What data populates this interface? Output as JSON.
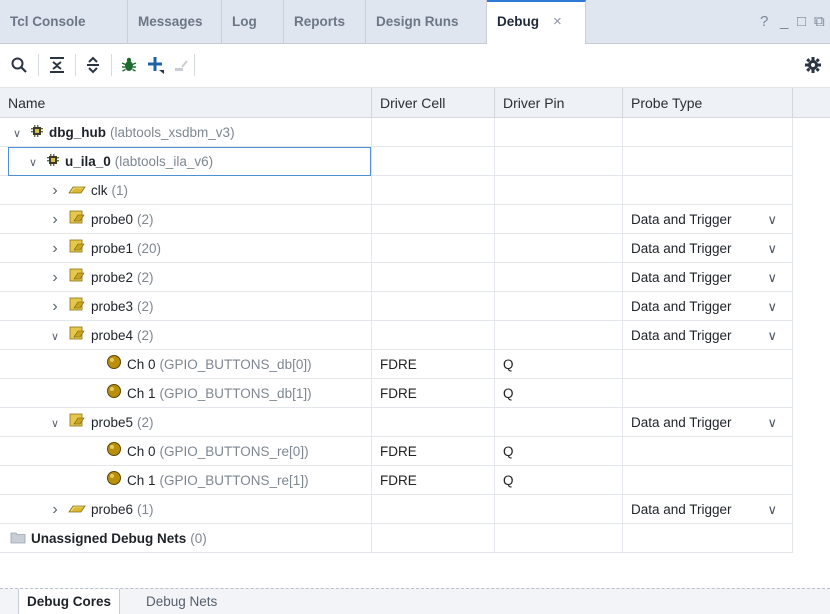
{
  "tabs": [
    {
      "label": "Tcl Console"
    },
    {
      "label": "Messages"
    },
    {
      "label": "Log"
    },
    {
      "label": "Reports"
    },
    {
      "label": "Design Runs"
    },
    {
      "label": "Debug",
      "active": true
    }
  ],
  "window_controls": {
    "help": "?",
    "minimize": "_",
    "restore": "□",
    "float": "⧉"
  },
  "toolbar": {
    "icons": [
      "search-icon",
      "collapse-all-icon",
      "expand-all-icon",
      "debug-bug-icon",
      "add-icon",
      "disabled-action-icon",
      "settings-gear-icon"
    ]
  },
  "columns": [
    "Name",
    "Driver Cell",
    "Driver Pin",
    "Probe Type"
  ],
  "rows": [
    {
      "indent": 0,
      "chev": "v",
      "icon": "core",
      "name": "dbg_hub",
      "detail": "(labtools_xsdbm_v3)",
      "cell": "",
      "pin": "",
      "type": ""
    },
    {
      "indent": 1,
      "chev": "v",
      "icon": "core",
      "name": "u_ila_0",
      "detail": "(labtools_ila_v6)",
      "cell": "",
      "pin": "",
      "type": ""
    },
    {
      "indent": 2,
      "chev": ">",
      "icon": "bus",
      "name": "clk",
      "detail": "(1)",
      "cell": "",
      "pin": "",
      "type": ""
    },
    {
      "indent": 2,
      "chev": ">",
      "icon": "probe",
      "name": "probe0",
      "detail": "(2)",
      "cell": "",
      "pin": "",
      "type": "Data and Trigger"
    },
    {
      "indent": 2,
      "chev": ">",
      "icon": "probe",
      "name": "probe1",
      "detail": "(20)",
      "cell": "",
      "pin": "",
      "type": "Data and Trigger"
    },
    {
      "indent": 2,
      "chev": ">",
      "icon": "probe",
      "name": "probe2",
      "detail": "(2)",
      "cell": "",
      "pin": "",
      "type": "Data and Trigger"
    },
    {
      "indent": 2,
      "chev": ">",
      "icon": "probe",
      "name": "probe3",
      "detail": "(2)",
      "cell": "",
      "pin": "",
      "type": "Data and Trigger"
    },
    {
      "indent": 2,
      "chev": "v",
      "icon": "probe",
      "name": "probe4",
      "detail": "(2)",
      "cell": "",
      "pin": "",
      "type": "Data and Trigger"
    },
    {
      "indent": 3,
      "chev": "",
      "icon": "net",
      "name": "Ch 0",
      "detail": "(GPIO_BUTTONS_db[0])",
      "cell": "FDRE",
      "pin": "Q",
      "type": ""
    },
    {
      "indent": 3,
      "chev": "",
      "icon": "net",
      "name": "Ch 1",
      "detail": "(GPIO_BUTTONS_db[1])",
      "cell": "FDRE",
      "pin": "Q",
      "type": ""
    },
    {
      "indent": 2,
      "chev": "v",
      "icon": "probe",
      "name": "probe5",
      "detail": "(2)",
      "cell": "",
      "pin": "",
      "type": "Data and Trigger"
    },
    {
      "indent": 3,
      "chev": "",
      "icon": "net",
      "name": "Ch 0",
      "detail": "(GPIO_BUTTONS_re[0])",
      "cell": "FDRE",
      "pin": "Q",
      "type": ""
    },
    {
      "indent": 3,
      "chev": "",
      "icon": "net",
      "name": "Ch 1",
      "detail": "(GPIO_BUTTONS_re[1])",
      "cell": "FDRE",
      "pin": "Q",
      "type": ""
    },
    {
      "indent": 2,
      "chev": ">",
      "icon": "bus",
      "name": "probe6",
      "detail": "(1)",
      "cell": "",
      "pin": "",
      "type": "Data and Trigger"
    },
    {
      "indent": 0,
      "chev": "",
      "icon": "folder",
      "name": "Unassigned Debug Nets",
      "detail": "(0)",
      "cell": "",
      "pin": "",
      "type": ""
    }
  ],
  "bottom_tabs": [
    {
      "label": "Debug Cores",
      "active": true
    },
    {
      "label": "Debug Nets"
    }
  ],
  "colors": {
    "accent": "#2f7ad6",
    "selection_border": "#4e8fd6",
    "header_bg": "#eef1f5"
  }
}
